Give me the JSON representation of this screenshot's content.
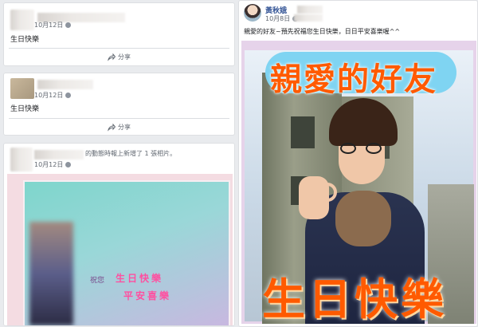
{
  "posts": [
    {
      "text": "生日快樂",
      "date": "10月12日",
      "share_label": "分享"
    },
    {
      "text": "生日快樂",
      "date": "10月12日",
      "share_label": "分享"
    },
    {
      "header_text": "的動態時報上新增了 1 張相片。",
      "date": "10月12日",
      "card_text": [
        "祝您",
        "生日快樂",
        "平安喜樂"
      ]
    }
  ],
  "featured": {
    "name": "黃秋娥",
    "date": "10月8日",
    "message": "親愛的好友~預先祝福您生日快樂，日日平安喜樂喔^^",
    "headline": "親愛的好友",
    "footer": "生日快樂"
  },
  "colors": {
    "accent_orange": "#ff5a00",
    "headline_bg": "#7fd4f2",
    "lavender": "#e9d6ef"
  }
}
